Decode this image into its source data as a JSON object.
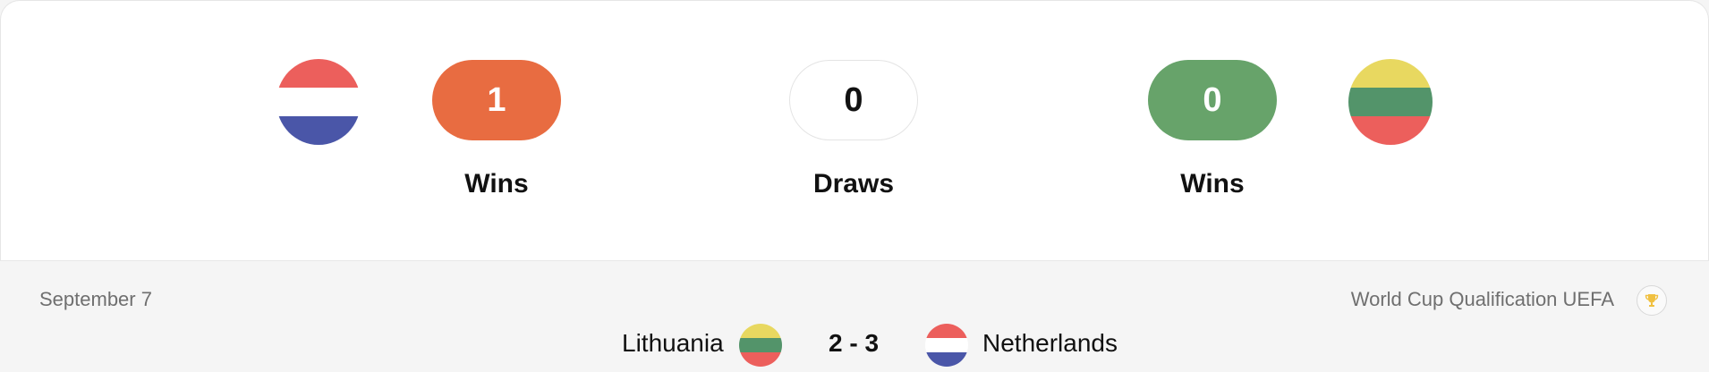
{
  "head_to_head": {
    "home_team_wins": "1",
    "draws": "0",
    "away_team_wins": "0",
    "home_wins_label": "Wins",
    "draws_label": "Draws",
    "away_wins_label": "Wins"
  },
  "flags": {
    "netherlands": [
      "#ec5f5c",
      "#ffffff",
      "#4a56a8"
    ],
    "lithuania": [
      "#e8d860",
      "#53946a",
      "#ec5f5c"
    ]
  },
  "colors": {
    "wins_home": "#e86c41",
    "wins_away": "#67a36a",
    "trophy": "#f0c040"
  },
  "match": {
    "date": "September 7",
    "competition": "World Cup Qualification UEFA",
    "competition_icon": "trophy-icon",
    "home_team": "Lithuania",
    "away_team": "Netherlands",
    "score": "2 - 3"
  }
}
